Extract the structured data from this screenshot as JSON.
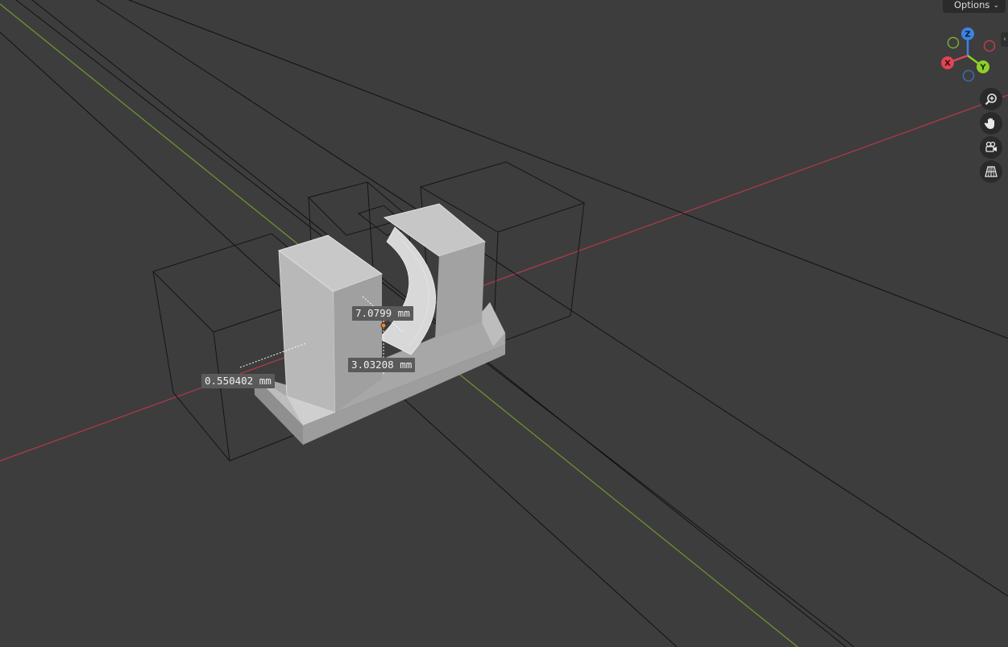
{
  "header": {
    "options_label": "Options",
    "options_chevron": "⌄"
  },
  "gizmo": {
    "x_label": "X",
    "y_label": "Y",
    "z_label": "Z"
  },
  "nav_buttons": [
    {
      "name": "zoom-icon"
    },
    {
      "name": "hand-pan-icon"
    },
    {
      "name": "camera-view-icon"
    },
    {
      "name": "perspective-grid-icon"
    }
  ],
  "measurements": {
    "horizontal": "7.0799 mm",
    "vertical": "3.03208 mm",
    "offset": "0.550402 mm"
  },
  "colors": {
    "background": "#3d3d3d",
    "x_axis": "#c53a4a",
    "y_axis": "#7fa835",
    "z_axis": "#3d82e0",
    "mesh_fill": "#b5b5b5"
  }
}
